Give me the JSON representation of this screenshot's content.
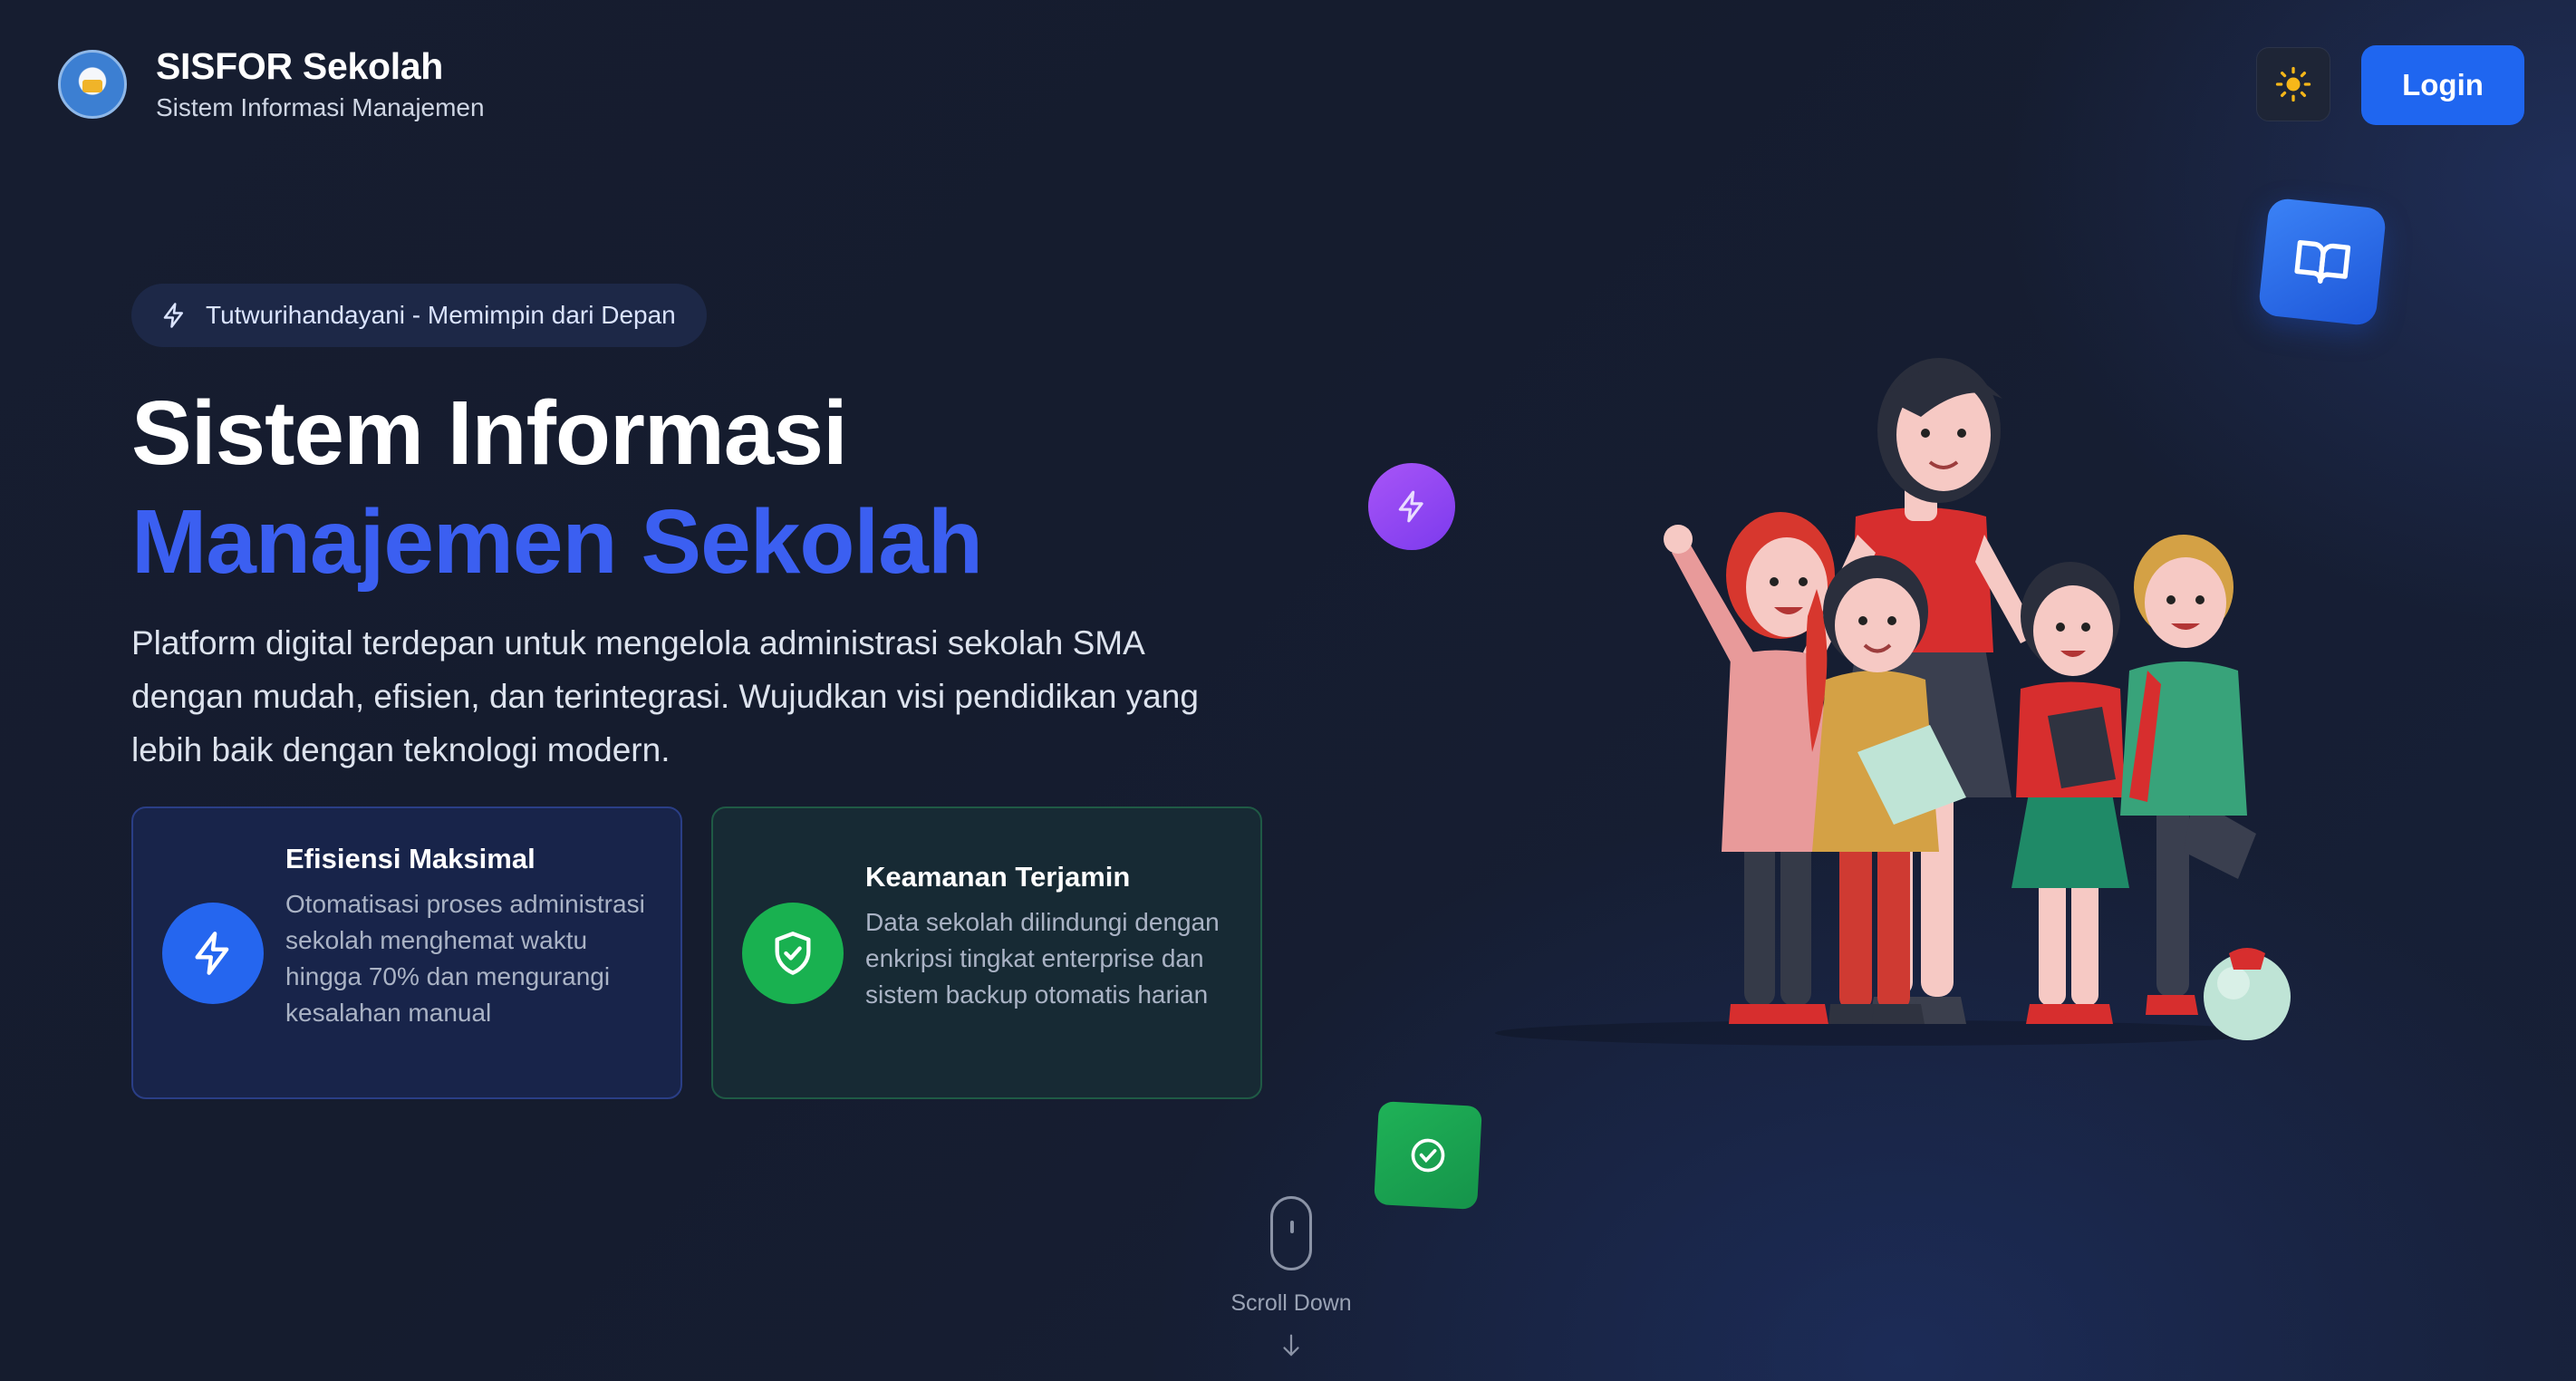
{
  "header": {
    "brand_title": "SISFOR Sekolah",
    "brand_subtitle": "Sistem Informasi Manajemen",
    "login_label": "Login",
    "theme_icon": "sun-icon"
  },
  "hero": {
    "badge": "Tutwurihandayani - Memimpin dari Depan",
    "title_line1": "Sistem Informasi",
    "title_line2": "Manajemen Sekolah",
    "description": "Platform digital terdepan untuk mengelola administrasi sekolah SMA dengan mudah, efisien, dan terintegrasi. Wujudkan visi pendidikan yang lebih baik dengan teknologi modern."
  },
  "features": [
    {
      "title": "Efisiensi Maksimal",
      "text": "Otomatisasi proses administrasi sekolah menghemat waktu hingga 70% dan mengurangi kesalahan manual",
      "icon": "bolt-icon",
      "color": "#2566ef"
    },
    {
      "title": "Keamanan Terjamin",
      "text": "Data sekolah dilindungi dengan enkripsi tingkat enterprise dan sistem backup otomatis harian",
      "icon": "shield-check-icon",
      "color": "#19b150"
    }
  ],
  "scroll": {
    "label": "Scroll Down"
  },
  "colors": {
    "accent": "#3b5ff1",
    "primary_button": "#1f66f0",
    "background": "#161d30"
  }
}
